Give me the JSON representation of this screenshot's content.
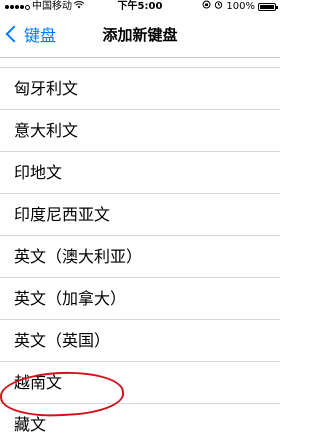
{
  "status_bar": {
    "carrier": "中国移动",
    "time": "下午5:00",
    "battery": "100%"
  },
  "nav": {
    "back_label": "键盘",
    "title": "添加新键盘"
  },
  "languages": [
    "匈牙利文",
    "意大利文",
    "印地文",
    "印度尼西亚文",
    "英文（澳大利亚）",
    "英文（加拿大）",
    "英文（英国）",
    "越南文",
    "藏文"
  ]
}
